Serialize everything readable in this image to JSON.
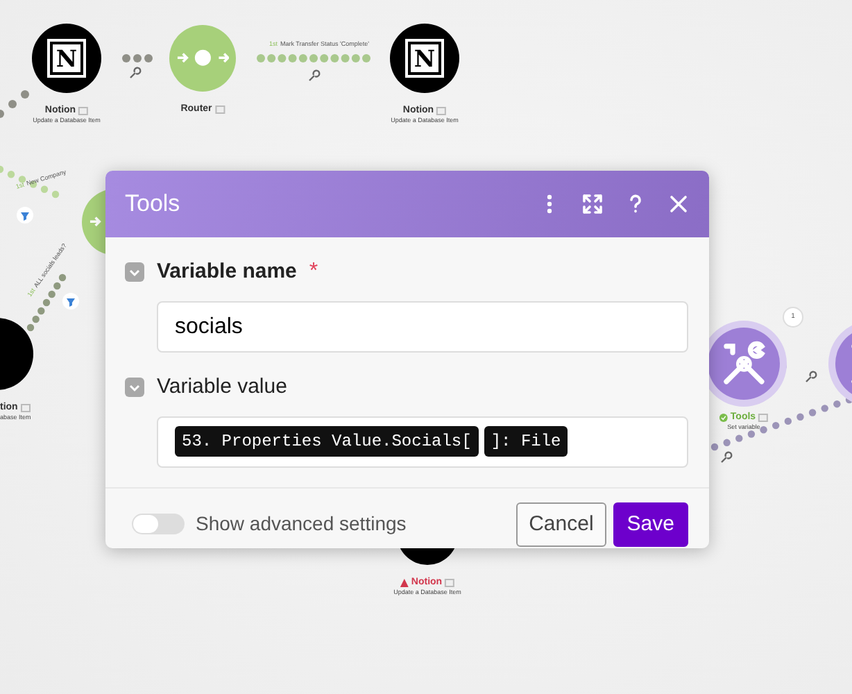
{
  "canvas": {
    "nodes": [
      {
        "kind": "notion",
        "logo": "N",
        "label": "Notion",
        "sublabel": "Update a Database Item",
        "warning": false,
        "success": false
      },
      {
        "kind": "router",
        "label": "Router",
        "warning": false,
        "success": false
      },
      {
        "kind": "notion",
        "logo": "N",
        "label": "Notion",
        "sublabel": "Update a Database Item",
        "warning": false,
        "success": false
      },
      {
        "kind": "router"
      },
      {
        "kind": "notion",
        "label": "tion",
        "sublabel": "abase Item",
        "warning": false,
        "success": false
      },
      {
        "kind": "tools",
        "label": "Tools",
        "sublabel": "Set variable",
        "warning": false,
        "success": true,
        "bubble": "1"
      },
      {
        "kind": "tools"
      },
      {
        "kind": "notion",
        "label": "Notion",
        "sublabel": "Update a Database Item",
        "warning": true,
        "success": false
      }
    ],
    "routes": [
      {
        "order": "1st",
        "label": "Mark Transfer Status 'Complete'"
      },
      {
        "order": "1st",
        "label": "New Company"
      },
      {
        "order": "1st",
        "label": "ALL socials leads?"
      }
    ]
  },
  "dialog": {
    "title": "Tools",
    "fields": [
      {
        "kind": "text",
        "label": "Variable name",
        "required_mark": "*",
        "value": "socials"
      },
      {
        "kind": "pills",
        "label": "Variable value",
        "pills": [
          "53. Properties Value.Socials[",
          "]: File"
        ]
      }
    ],
    "advanced": {
      "label": "Show advanced settings",
      "on": false
    },
    "buttons": [
      {
        "kind": "secondary",
        "label": "Cancel"
      },
      {
        "kind": "primary",
        "label": "Save"
      }
    ]
  }
}
